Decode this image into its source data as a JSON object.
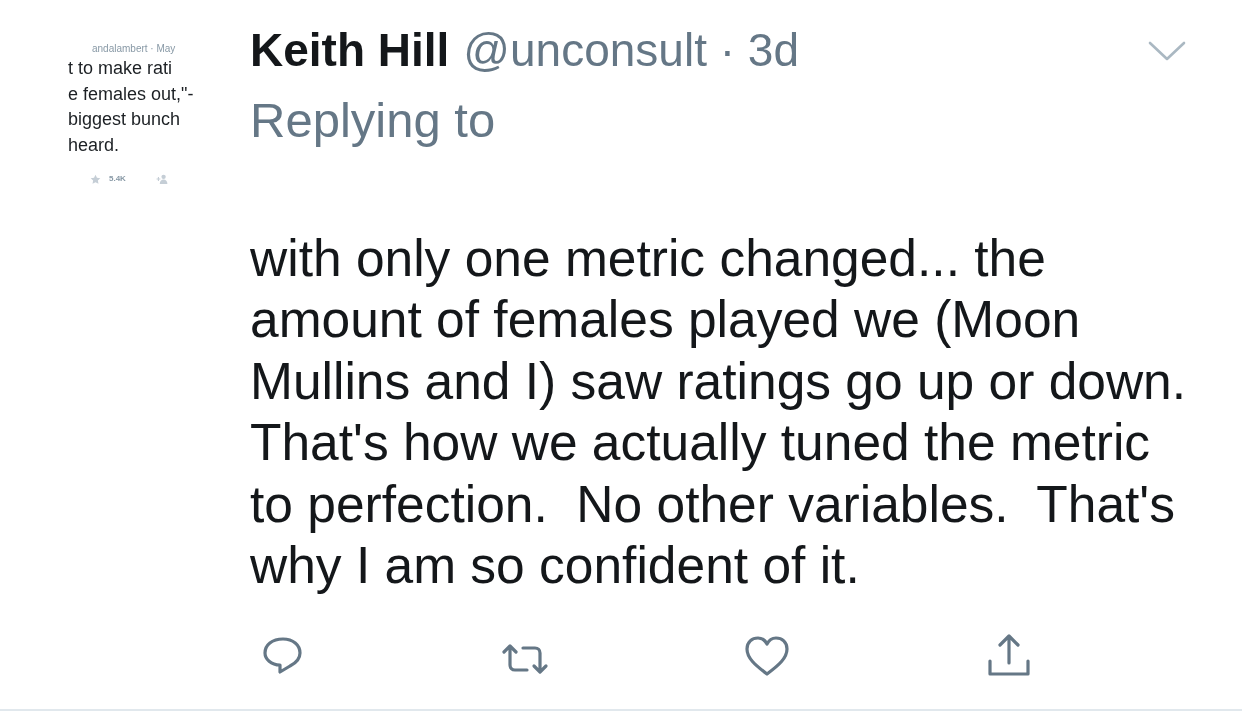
{
  "quoted_screenshot": {
    "byline": "andalambert · May",
    "lines": [
      "t to make rati",
      "e females out,\"-",
      "biggest bunch",
      "heard."
    ],
    "like_count": "5.4K"
  },
  "tweet": {
    "name": "Keith Hill",
    "handle_line": "@unconsult · 3d",
    "replying_to": "Replying to",
    "text": "with only one metric changed... the amount of females played we (Moon Mullins and I) saw ratings go up or down.  That's how we actually tuned the metric to perfection.  No other variables.  That's why I am so confident of it.",
    "actions": [
      {
        "kind": "reply"
      },
      {
        "kind": "retweet"
      },
      {
        "kind": "like"
      },
      {
        "kind": "share"
      }
    ]
  }
}
